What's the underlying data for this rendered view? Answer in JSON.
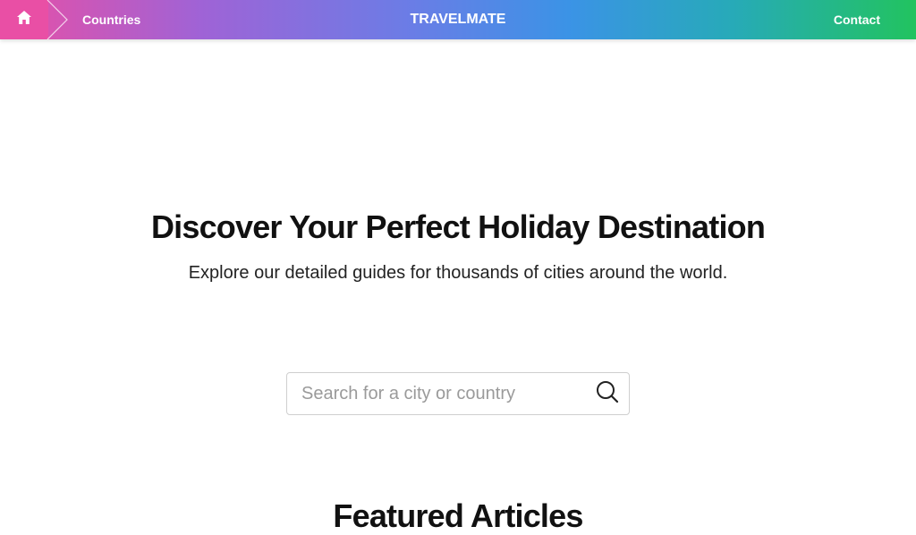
{
  "nav": {
    "home_icon": "home-icon",
    "breadcrumb_separator_icon": "chevron-right-icon",
    "breadcrumb_countries": "Countries",
    "brand": "TRAVELMATE",
    "contact": "Contact",
    "gradient_colors": [
      "#e94fa5",
      "#9f63d6",
      "#6a7de6",
      "#3b93e6",
      "#27aab8",
      "#22c35f"
    ]
  },
  "hero": {
    "title": "Discover Your Perfect Holiday Destination",
    "subtitle": "Explore our detailed guides for thousands of cities around the world."
  },
  "search": {
    "placeholder": "Search for a city or country",
    "value": "",
    "icon": "search-icon"
  },
  "featured": {
    "title": "Featured Articles"
  }
}
